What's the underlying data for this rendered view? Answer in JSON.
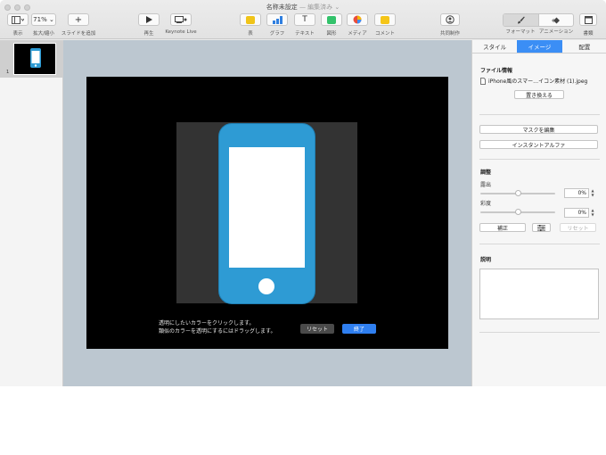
{
  "window": {
    "title": "名称未設定",
    "title_suffix": "— 編集済み ⌄"
  },
  "toolbar": {
    "view_label": "表示",
    "zoom_value": "71% ⌄",
    "zoom_label": "拡大/縮小",
    "add_slide_label": "スライドを追加",
    "play_label": "再生",
    "keynote_live_label": "Keynote Live",
    "table_label": "表",
    "chart_label": "グラフ",
    "text_label": "テキスト",
    "shape_label": "図形",
    "media_label": "メディア",
    "comment_label": "コメント",
    "collaborate_label": "共同制作",
    "format_label": "フォーマット",
    "animate_label": "アニメーション",
    "document_label": "書類"
  },
  "navigator": {
    "slide_number": "1"
  },
  "instant_alpha": {
    "message_line1": "透明にしたいカラーをクリックします。",
    "message_line2": "類似のカラーを透明にするにはドラッグします。",
    "reset_label": "リセット",
    "done_label": "終了"
  },
  "inspector": {
    "tabs": [
      "スタイル",
      "イメージ",
      "配置"
    ],
    "file_info_heading": "ファイル情報",
    "file_name": "iPhone風のスマー…イコン素材 (1).jpeg",
    "replace_label": "置き換える",
    "edit_mask_label": "マスクを編集",
    "instant_alpha_label": "インスタントアルファ",
    "adjust_heading": "調整",
    "exposure_label": "露出",
    "exposure_value": "0%",
    "exposure_level": 0.5,
    "saturation_label": "彩度",
    "saturation_value": "0%",
    "saturation_level": 0.5,
    "enhance_label": "補正",
    "reset_label": "リセット",
    "description_heading": "説明",
    "description_value": ""
  },
  "colors": {
    "accent": "#3b8ef5",
    "phone_blue": "#2e9bd4",
    "canvas_bg": "#bcc7d0"
  }
}
